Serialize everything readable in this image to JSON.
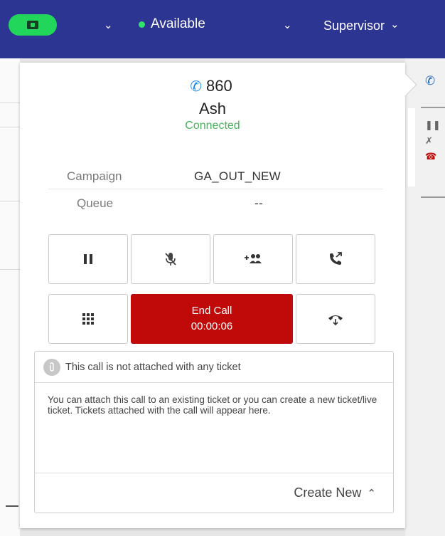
{
  "topbar": {
    "status": "Available",
    "role": "Supervisor",
    "colors": {
      "bar": "#2d3592",
      "status_pill": "#22d65c",
      "status_dot": "#2ee56a"
    }
  },
  "call": {
    "number": "860",
    "name": "Ash",
    "state": "Connected",
    "fields": [
      {
        "label": "Campaign",
        "value": "GA_OUT_NEW"
      },
      {
        "label": "Queue",
        "value": "--"
      }
    ],
    "controls": [
      {
        "icon": "pause-icon"
      },
      {
        "icon": "mic-off-icon"
      },
      {
        "icon": "add-participant-icon"
      },
      {
        "icon": "call-transfer-icon"
      },
      {
        "icon": "dialpad-icon"
      },
      {
        "icon": "hangup-icon"
      }
    ],
    "end_call": {
      "label": "End Call",
      "timer": "00:00:06",
      "color": "#c00a0a"
    }
  },
  "ticket": {
    "header": "This call is not attached with any ticket",
    "description": "You can attach this call to an existing ticket or you can create a new ticket/live ticket. Tickets attached with the call will appear here.",
    "create_label": "Create New"
  }
}
